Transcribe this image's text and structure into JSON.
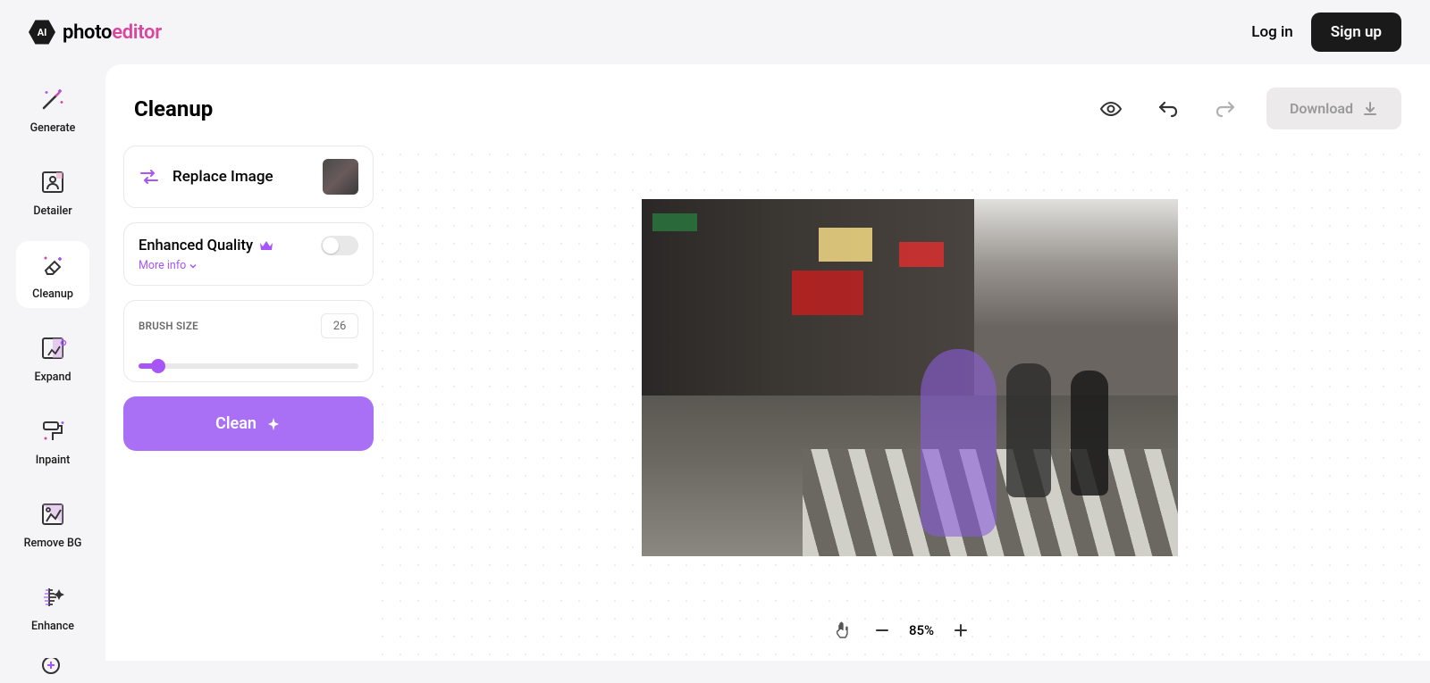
{
  "brand": {
    "badge": "AI",
    "name_a": "photo",
    "name_b": "editor"
  },
  "header": {
    "login": "Log in",
    "signup": "Sign up"
  },
  "nav": [
    {
      "label": "Generate"
    },
    {
      "label": "Detailer"
    },
    {
      "label": "Cleanup"
    },
    {
      "label": "Expand"
    },
    {
      "label": "Inpaint"
    },
    {
      "label": "Remove BG"
    },
    {
      "label": "Enhance"
    }
  ],
  "page": {
    "title": "Cleanup",
    "download": "Download"
  },
  "replace": {
    "label": "Replace Image"
  },
  "enhanced": {
    "title": "Enhanced Quality",
    "more": "More info"
  },
  "brush": {
    "label": "BRUSH SIZE",
    "value": "26"
  },
  "clean": {
    "label": "Clean"
  },
  "zoom": {
    "value": "85%"
  }
}
